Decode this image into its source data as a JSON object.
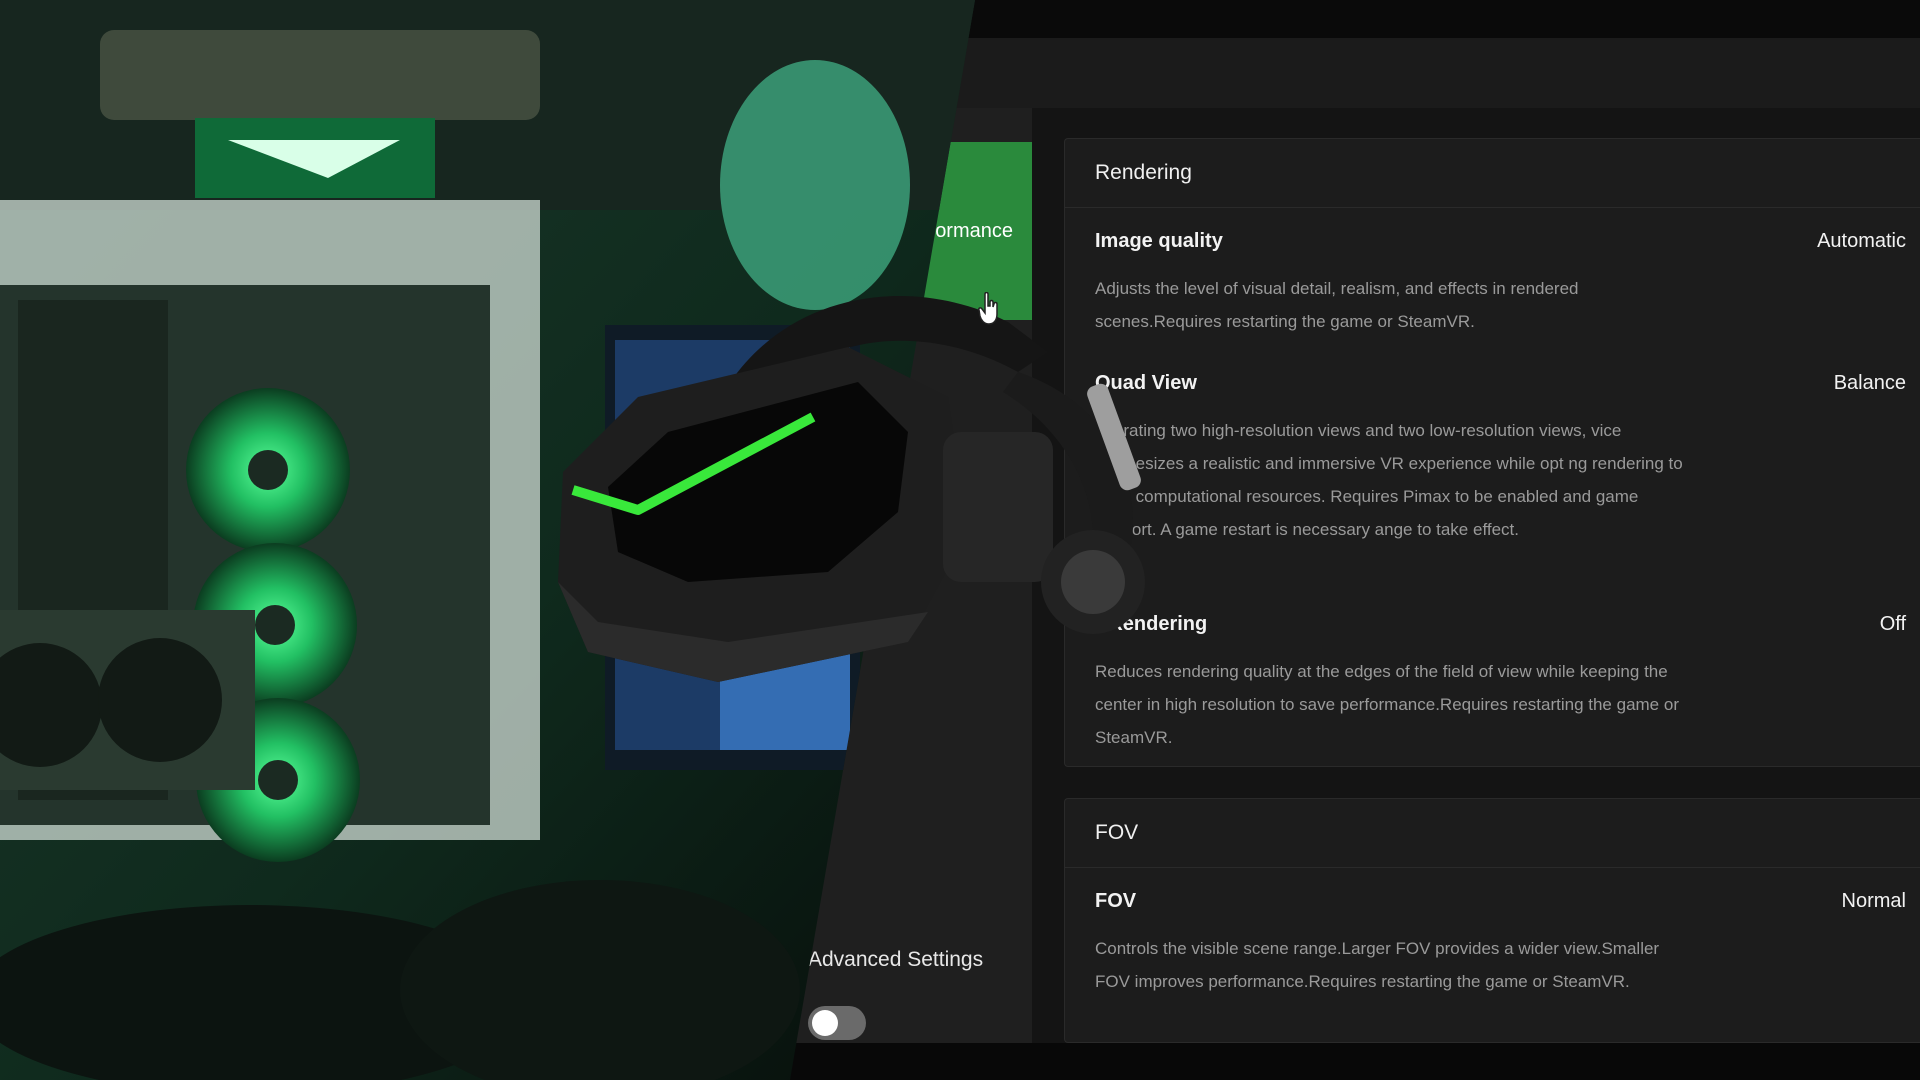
{
  "nav": {
    "active_item_label": "ormance",
    "advanced_settings_label": "Advanced Settings",
    "advanced_settings_enabled": false
  },
  "rendering": {
    "title": "Rendering",
    "settings": [
      {
        "title": "Image quality",
        "value": "Automatic",
        "description": "Adjusts the level of visual detail, realism, and effects in rendered scenes.Requires restarting the game or SteamVR."
      },
      {
        "title": "Quad View",
        "value": "Balance",
        "description": "enerating two high-resolution views and two low-resolution views, vice synthesizes a realistic and immersive VR experience while opt ng rendering to save computational resources. Requires Pimax to be enabled and game support. A game restart is necessary ange to take effect."
      },
      {
        "title": "r Rendering",
        "value": "Off",
        "description": "Reduces rendering quality at the edges of the field of view while keeping the center in high resolution to save performance.Requires restarting the game or SteamVR."
      }
    ]
  },
  "fov": {
    "title": "FOV",
    "settings": [
      {
        "title": "FOV",
        "value": "Normal",
        "description": "Controls the visible scene range.Larger FOV provides a wider view.Smaller FOV improves performance.Requires restarting the game or SteamVR."
      }
    ]
  },
  "colors": {
    "accent": "#2a8a3c",
    "background": "#111111",
    "card": "#1c1c1c",
    "text_muted": "#9a9a9a"
  },
  "icons": {
    "cursor": "hand-pointer-icon"
  }
}
